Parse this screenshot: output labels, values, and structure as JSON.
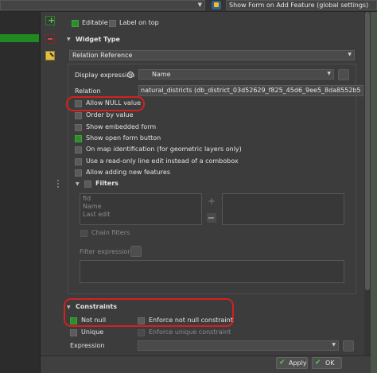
{
  "toolbar": {
    "top_dropdown": "",
    "python_icon": "python-icon",
    "show_form_label": "Show Form on Add Feature (global settings)"
  },
  "general": {
    "editable_label": "Editable",
    "label_on_top_label": "Label on top"
  },
  "widget_type": {
    "header": "Widget Type",
    "selected": "Relation Reference"
  },
  "relation_ref": {
    "display_expression_label": "Display expression",
    "display_expression_value": "Name",
    "relation_label": "Relation",
    "relation_value": "natural_districts (db_district_03d52629_f825_45d6_9ee5_8da8552b5",
    "options": [
      {
        "label": "Allow NULL value",
        "checked": false
      },
      {
        "label": "Order by value",
        "checked": false
      },
      {
        "label": "Show embedded form",
        "checked": false
      },
      {
        "label": "Show open form button",
        "checked": true
      },
      {
        "label": "On map identification (for geometric layers only)",
        "checked": false
      },
      {
        "label": "Use a read-only line edit instead of a combobox",
        "checked": false
      },
      {
        "label": "Allow adding new features",
        "checked": false
      }
    ],
    "filters_label": "Filters",
    "filter_fields": [
      "fid",
      "Name",
      "Last edit"
    ],
    "chain_filters_label": "Chain filters",
    "filter_expression_label": "Filter expression"
  },
  "constraints": {
    "header": "Constraints",
    "not_null_label": "Not null",
    "not_null_checked": true,
    "enforce_not_null_label": "Enforce not null constraint",
    "unique_label": "Unique",
    "enforce_unique_label": "Enforce unique constraint",
    "expression_label": "Expression"
  },
  "dialog_buttons": {
    "apply": "Apply",
    "ok": "OK"
  },
  "colors": {
    "highlight_ring": "#d42020",
    "checked_green": "#2e8b2e",
    "selection_green": "#1f8a1f"
  }
}
